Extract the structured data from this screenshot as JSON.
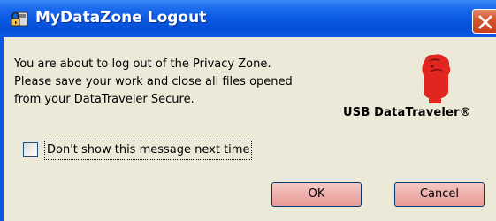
{
  "window": {
    "title": "MyDataZone Logout",
    "app_icon": "padlock-drive-icon",
    "close_icon": "close-x-icon"
  },
  "message": {
    "lines": [
      "You are about to log out of the Privacy Zone.",
      "Please save your work and close all files opened",
      "from your DataTraveler Secure."
    ]
  },
  "logo": {
    "icon": "kingston-logo-icon",
    "text": "USB DataTraveler®"
  },
  "checkbox": {
    "label": "Don't show this message next time",
    "checked": false
  },
  "buttons": {
    "ok_label": "OK",
    "cancel_label": "Cancel"
  },
  "colors": {
    "titlebar": "#0a57e0",
    "client": "#ece9d8",
    "button_face": "#eeb1ad",
    "close_button": "#d4552d",
    "logo_red": "#e0261f"
  }
}
